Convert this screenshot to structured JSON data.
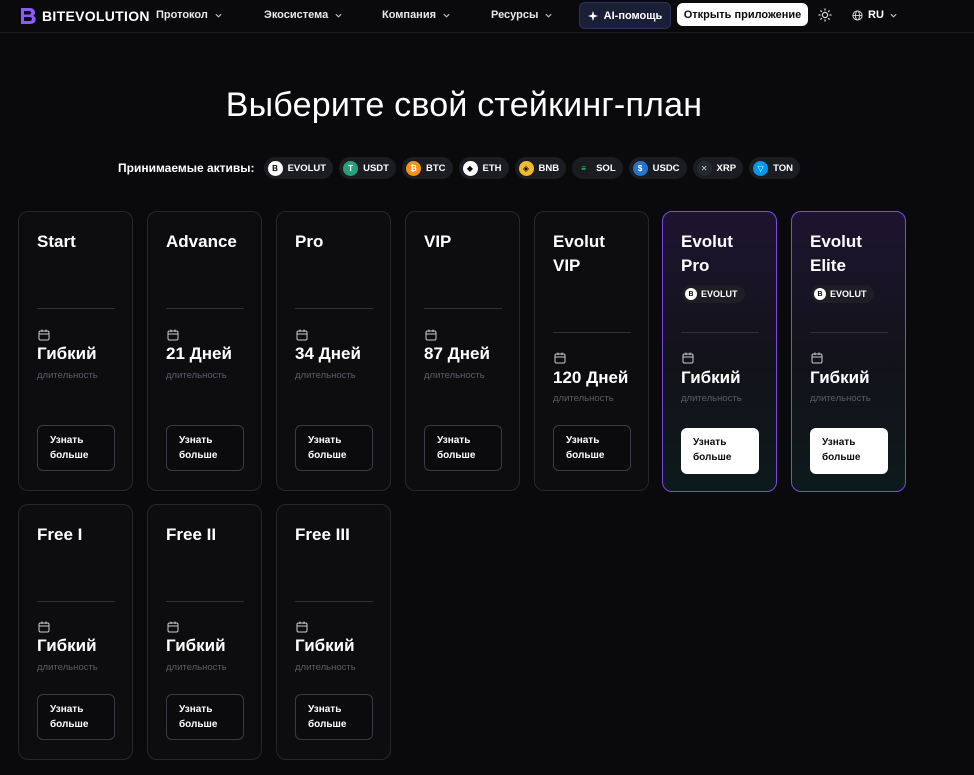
{
  "nav": {
    "logo_text": "BITEVOLUTION",
    "items": [
      {
        "label": "Протокол"
      },
      {
        "label": "Экосистема"
      },
      {
        "label": "Компания"
      },
      {
        "label": "Ресурсы"
      }
    ],
    "ai_label": "AI-помощь",
    "open_app_label": "Открыть приложение",
    "language": "RU"
  },
  "page": {
    "title": "Выберите свой стейкинг-план",
    "assets_label": "Принимаемые активы:"
  },
  "assets": [
    {
      "label": "EVOLUT",
      "color": "#ffffff",
      "icon": "evolut-coin-icon"
    },
    {
      "label": "USDT",
      "color": "#26a17b",
      "icon": "usdt-coin-icon"
    },
    {
      "label": "BTC",
      "color": "#f7931a",
      "icon": "btc-coin-icon"
    },
    {
      "label": "ETH",
      "color": "#ffffff",
      "icon": "eth-coin-icon"
    },
    {
      "label": "BNB",
      "color": "#f3ba2f",
      "icon": "bnb-coin-icon"
    },
    {
      "label": "SOL",
      "color": "#1b1b1f",
      "icon": "sol-coin-icon"
    },
    {
      "label": "USDC",
      "color": "#2775ca",
      "icon": "usdc-coin-icon"
    },
    {
      "label": "XRP",
      "color": "#23292f",
      "icon": "xrp-coin-icon"
    },
    {
      "label": "TON",
      "color": "#0098ea",
      "icon": "ton-coin-icon"
    }
  ],
  "plans": [
    {
      "name": "Start",
      "duration": "Гибкий",
      "duration_label": "длительность",
      "cta": "Узнать\nбольше"
    },
    {
      "name": "Advance",
      "duration": "21 Дней",
      "duration_label": "длительность",
      "cta": "Узнать\nбольше"
    },
    {
      "name": "Pro",
      "duration": "34 Дней",
      "duration_label": "длительность",
      "cta": "Узнать\nбольше"
    },
    {
      "name": "VIP",
      "duration": "87 Дней",
      "duration_label": "длительность",
      "cta": "Узнать\nбольше"
    },
    {
      "name": "Evolut\nVIP",
      "duration": "120 Дней",
      "duration_label": "длительность",
      "cta": "Узнать\nбольше"
    },
    {
      "name": "Evolut\nPro",
      "badge": "EVOLUT",
      "duration": "Гибкий",
      "duration_label": "длительность",
      "cta": "Узнать\nбольше"
    },
    {
      "name": "Evolut\nElite",
      "badge": "EVOLUT",
      "duration": "Гибкий",
      "duration_label": "длительность",
      "cta": "Узнать\nбольше"
    },
    {
      "name": "Free I",
      "duration": "Гибкий",
      "duration_label": "длительность",
      "cta": "Узнать\nбольше"
    },
    {
      "name": "Free II",
      "duration": "Гибкий",
      "duration_label": "длительность",
      "cta": "Узнать\nбольше"
    },
    {
      "name": "Free III",
      "duration": "Гибкий",
      "duration_label": "длительность",
      "cta": "Узнать\nбольше"
    }
  ],
  "colors": {
    "accent": "#7b4be0",
    "background": "#0a0a0c"
  }
}
